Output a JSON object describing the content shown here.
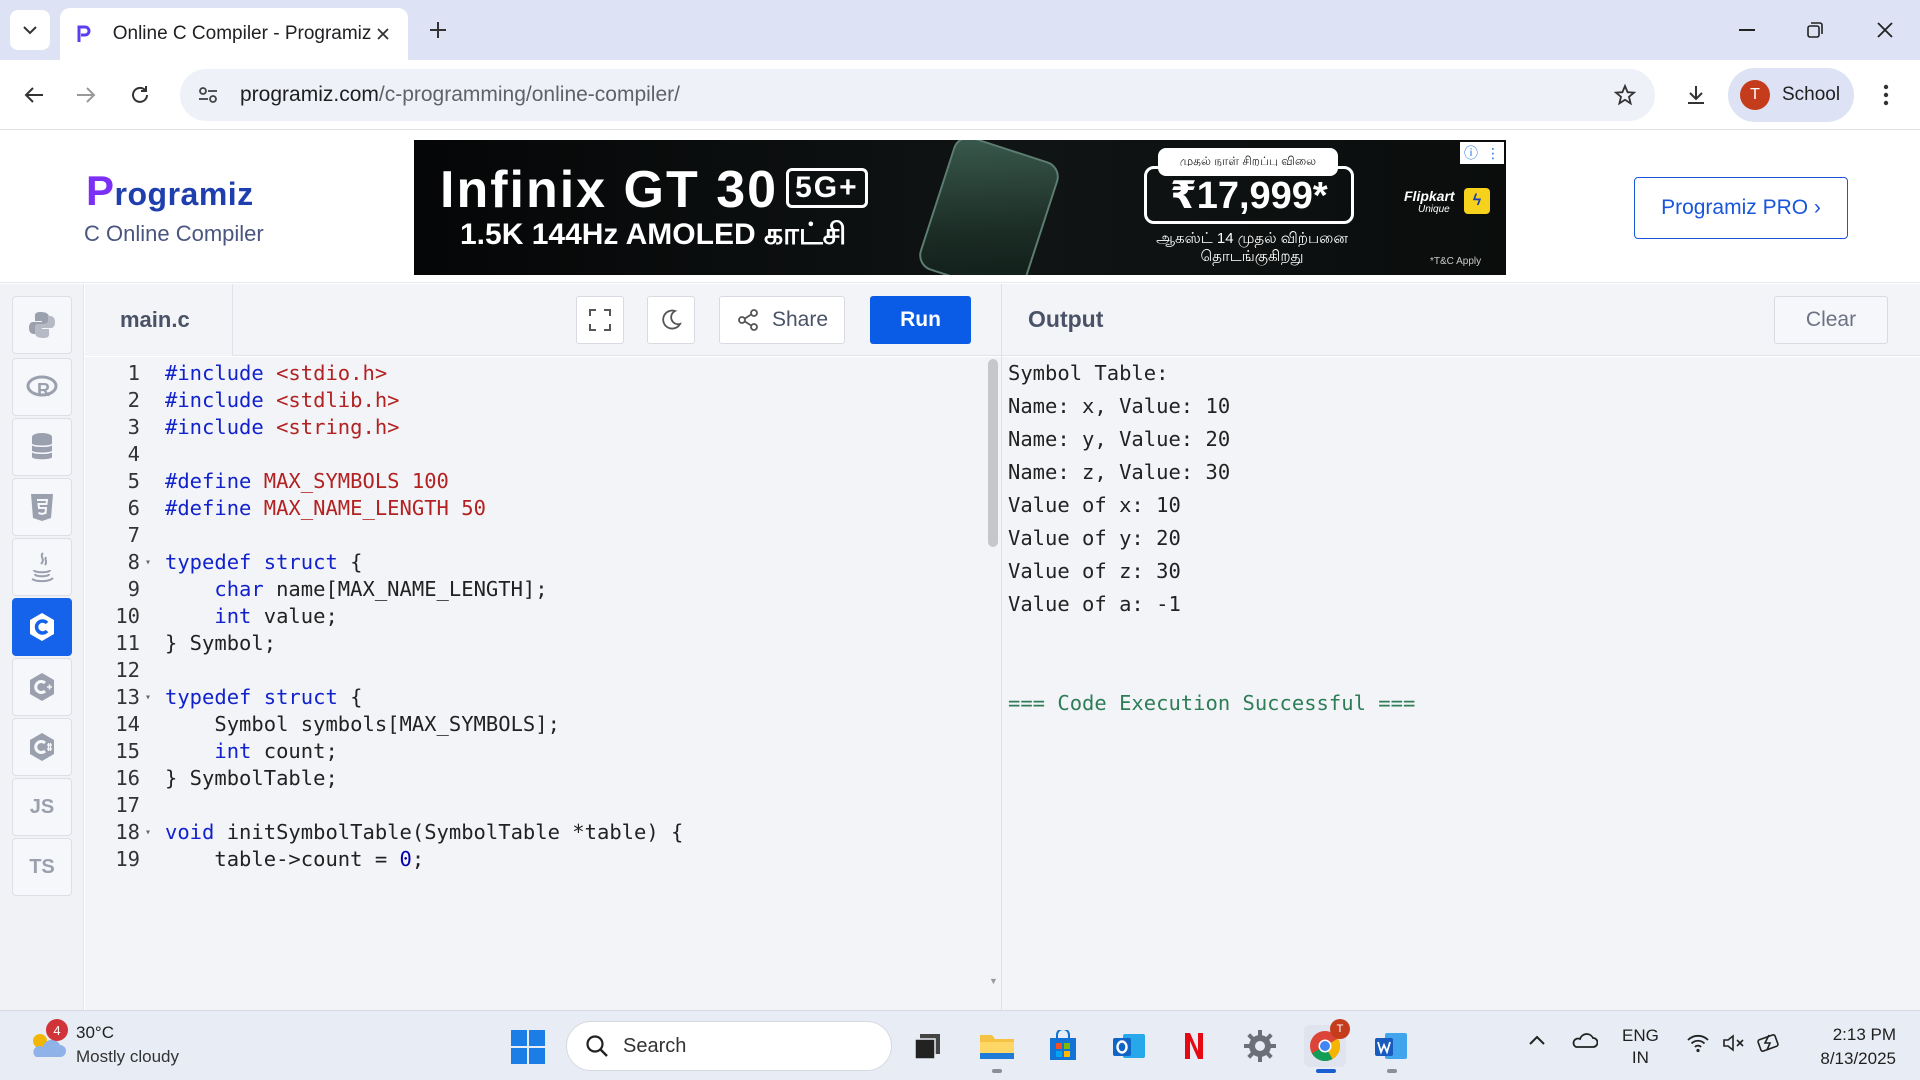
{
  "browser": {
    "tab_title": "Online C Compiler - Programiz",
    "url_host": "programiz.com",
    "url_path": "/c-programming/online-compiler/",
    "profile_initial": "T",
    "profile_label": "School"
  },
  "site": {
    "logo": "rogramiz",
    "logo_p": "P",
    "subtitle": "C Online Compiler",
    "pro_button": "Programiz PRO ›"
  },
  "ad": {
    "title": "Infinix GT 30",
    "badge": "5G+",
    "subtitle": "1.5K 144Hz AMOLED காட்சி",
    "price_caption": "முதல் நாள் சிறப்பு விலை",
    "price": "₹17,999*",
    "launch_line1": "ஆகஸ்ட் 14 முதல் விற்பனை",
    "launch_line2": "தொடங்குகிறது",
    "brand": "Flipkart",
    "brand_sub": "Unique",
    "tc": "*T&C Apply"
  },
  "editor": {
    "file_name": "main.c",
    "share_label": "Share",
    "run_label": "Run",
    "lines": [
      {
        "n": "1",
        "fold": ""
      },
      {
        "n": "2",
        "fold": ""
      },
      {
        "n": "3",
        "fold": ""
      },
      {
        "n": "4",
        "fold": ""
      },
      {
        "n": "5",
        "fold": ""
      },
      {
        "n": "6",
        "fold": ""
      },
      {
        "n": "7",
        "fold": ""
      },
      {
        "n": "8",
        "fold": "▾"
      },
      {
        "n": "9",
        "fold": ""
      },
      {
        "n": "10",
        "fold": ""
      },
      {
        "n": "11",
        "fold": ""
      },
      {
        "n": "12",
        "fold": ""
      },
      {
        "n": "13",
        "fold": "▾"
      },
      {
        "n": "14",
        "fold": ""
      },
      {
        "n": "15",
        "fold": ""
      },
      {
        "n": "16",
        "fold": ""
      },
      {
        "n": "17",
        "fold": ""
      },
      {
        "n": "18",
        "fold": "▾"
      },
      {
        "n": "19",
        "fold": ""
      }
    ],
    "code": {
      "l1_kw": "#include",
      "l1_str": " <stdio.h>",
      "l2_kw": "#include",
      "l2_str": " <stdlib.h>",
      "l3_kw": "#include",
      "l3_str": " <string.h>",
      "l5_kw": "#define",
      "l5_str": " MAX_SYMBOLS 100",
      "l6_kw": "#define",
      "l6_str": " MAX_NAME_LENGTH 50",
      "l8_kw": "typedef struct",
      "l8_rest": " {",
      "l9_indent": "    ",
      "l9_kw": "char",
      "l9_rest": " name[MAX_NAME_LENGTH];",
      "l10_indent": "    ",
      "l10_kw": "int",
      "l10_rest": " value;",
      "l11": "} Symbol;",
      "l13_kw": "typedef struct",
      "l13_rest": " {",
      "l14": "    Symbol symbols[MAX_SYMBOLS];",
      "l15_indent": "    ",
      "l15_kw": "int",
      "l15_rest": " count;",
      "l16": "} SymbolTable;",
      "l18_kw": "void",
      "l18_rest": " initSymbolTable(SymbolTable *table) {",
      "l19_a": "    table->count = ",
      "l19_num": "0",
      "l19_b": ";"
    }
  },
  "output": {
    "title": "Output",
    "clear_label": "Clear",
    "lines": [
      "Symbol Table:",
      "Name: x, Value: 10",
      "Name: y, Value: 20",
      "Name: z, Value: 30",
      "Value of x: 10",
      "Value of y: 20",
      "Value of z: 30",
      "Value of a: -1"
    ],
    "success": "=== Code Execution Successful ==="
  },
  "sidebar": {
    "items": [
      "python",
      "r",
      "sql",
      "html",
      "java",
      "c",
      "c++",
      "c#",
      "JS",
      "TS"
    ],
    "active": "c"
  },
  "taskbar": {
    "weather_badge": "4",
    "temperature": "30°C",
    "weather_desc": "Mostly cloudy",
    "search_label": "Search",
    "lang_line1": "ENG",
    "lang_line2": "IN",
    "time": "2:13 PM",
    "date": "8/13/2025"
  },
  "colors": {
    "accent": "#0a5ce6",
    "success": "#2e7d57"
  }
}
